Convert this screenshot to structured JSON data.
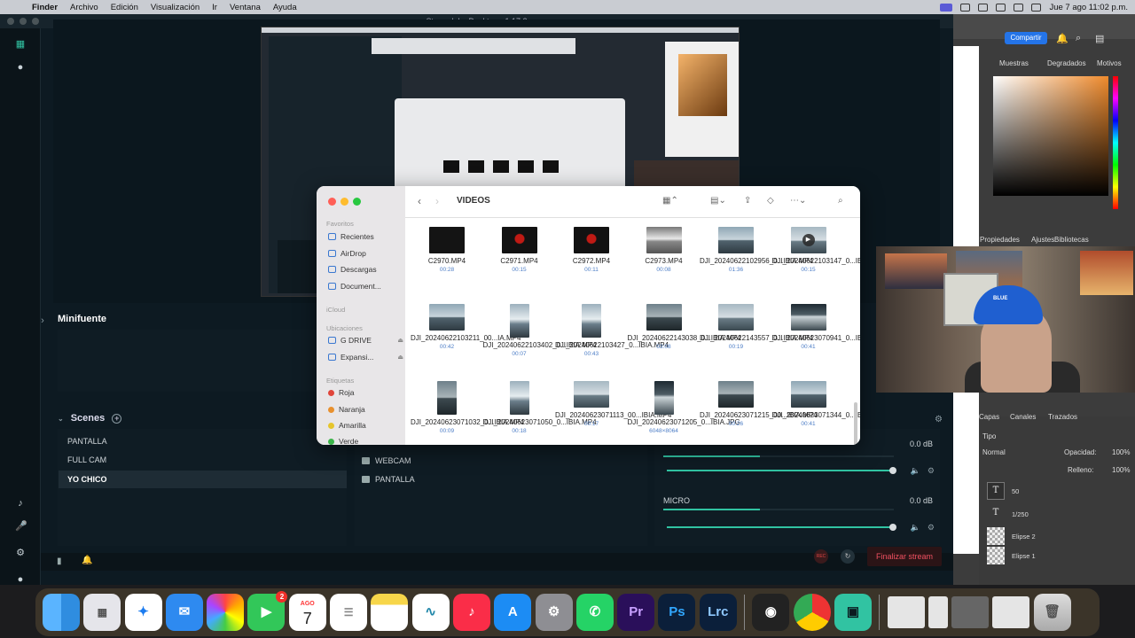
{
  "menubar": {
    "app": "Finder",
    "items": [
      "Archivo",
      "Edición",
      "Visualización",
      "Ir",
      "Ventana",
      "Ayuda"
    ],
    "clock": "Jue 7 ago 11:02 p.m."
  },
  "streamlabs": {
    "title": "Streamlabs Desktop - 1.17.2",
    "minifuente_title": "Minifuente",
    "scenes_title": "Scenes",
    "scenes": [
      "PANTALLA",
      "FULL CAM",
      "YO CHICO"
    ],
    "selected_scene": "YO CHICO",
    "sources": [
      "WEBCAM",
      "PANTALLA"
    ],
    "mixer": [
      {
        "name": "",
        "db": "0.0 dB",
        "level": 0.42
      },
      {
        "name": "MICRO",
        "db": "0.0 dB",
        "level": 0.42
      }
    ],
    "rec_label": "REC",
    "end_stream": "Finalizar stream"
  },
  "finder": {
    "folder": "VIDEOS",
    "sidebar": {
      "favoritos_label": "Favoritos",
      "favoritos": [
        "Recientes",
        "AirDrop",
        "Descargas",
        "Document..."
      ],
      "icloud_label": "iCloud",
      "ubicaciones_label": "Ubicaciones",
      "ubicaciones": [
        "G DRIVE",
        "Expansi..."
      ],
      "etiquetas_label": "Etiquetas",
      "etiquetas": [
        {
          "name": "Roja",
          "color": "#e0453a"
        },
        {
          "name": "Naranja",
          "color": "#e8902e"
        },
        {
          "name": "Amarilla",
          "color": "#e6c52c"
        },
        {
          "name": "Verde",
          "color": "#3cb54a"
        }
      ]
    },
    "files": [
      {
        "name": "C2970.MP4",
        "meta": "00:28"
      },
      {
        "name": "C2971.MP4",
        "meta": "00:15"
      },
      {
        "name": "C2972.MP4",
        "meta": "00:11"
      },
      {
        "name": "C2973.MP4",
        "meta": "00:08"
      },
      {
        "name": "DJI_20240622102956_0...IBIA.MP4",
        "meta": "01:36"
      },
      {
        "name": "DJI_20240622103147_0...IBIA.MP4",
        "meta": "00:15"
      },
      {
        "name": "DJI_20240622103211_00...IA.MP4",
        "meta": "00:42"
      },
      {
        "name": "DJI_20240622103402_0...IBIA.MP4",
        "meta": "00:07"
      },
      {
        "name": "DJI_20240622103427_0...IBIA.MP4",
        "meta": "00:43"
      },
      {
        "name": "DJI_20240622143038_0...IBIA.MP4",
        "meta": "03:08"
      },
      {
        "name": "DJI_20240622143557_0...IBIA.MP4",
        "meta": "00:19"
      },
      {
        "name": "DJI_20240623070941_0...IBIA.MP4",
        "meta": "00:41"
      },
      {
        "name": "DJI_20240623071032_0...IBIA.MP4",
        "meta": "00:09"
      },
      {
        "name": "DJI_20240623071050_0...IBIA.MP4",
        "meta": "00:18"
      },
      {
        "name": "DJI_20240623071113_00...IBIA.MP4",
        "meta": "00:17"
      },
      {
        "name": "DJI_20240623071205_0...IBIA.JPG",
        "meta": "6048×8064"
      },
      {
        "name": "DJI_20240623071215_00...IBIA.MP4",
        "meta": "00:26"
      },
      {
        "name": "DJI_20240623071344_0...IBIA.MP4",
        "meta": "00:41"
      }
    ]
  },
  "photoshop": {
    "share": "Compartir",
    "top_tabs": [
      "Muestras",
      "Degradados",
      "Motivos"
    ],
    "mid_tabs": [
      "Propiedades",
      "Ajustes",
      "Bibliotecas"
    ],
    "layer_tabs": [
      "Capas",
      "Canales",
      "Trazados"
    ],
    "blend_mode": "Normal",
    "opacity_label": "Opacidad:",
    "opacity": "100%",
    "fill_label": "Relleno:",
    "fill": "100%",
    "kind_filter": "Tipo",
    "layers": [
      "50",
      "1/250",
      "Elipse 2",
      "Elipse 1"
    ]
  },
  "dock": {
    "facetime_badge": "2",
    "calendar_month": "AGO",
    "calendar_day": "7",
    "apps": [
      "Pr",
      "Ps",
      "Lrc"
    ]
  }
}
